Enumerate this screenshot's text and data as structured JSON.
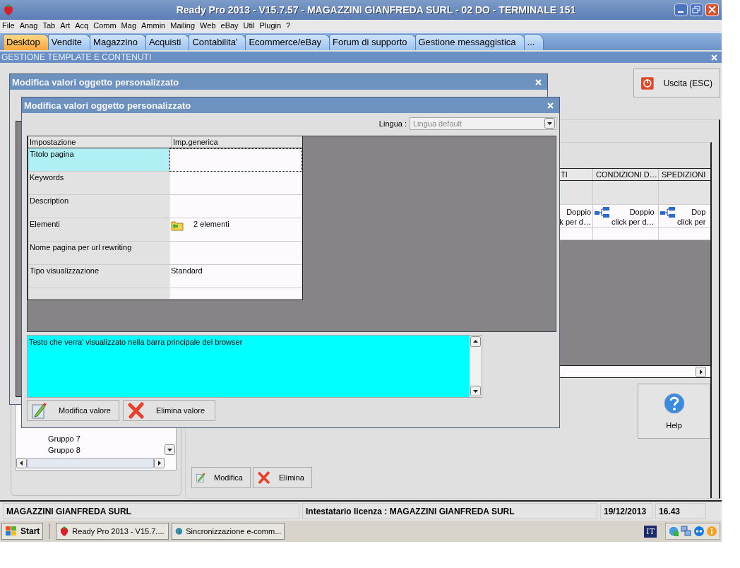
{
  "window": {
    "title": "Ready Pro 2013 - V15.7.57 - MAGAZZINI GIANFREDA SURL - 02 DO - TERMINALE 151"
  },
  "menu": [
    "File",
    "Anag",
    "Tab",
    "Art",
    "Acq",
    "Comm",
    "Mag",
    "Ammin",
    "Mailing",
    "Web",
    "eBay",
    "Util",
    "Plugin",
    "?"
  ],
  "tabs": [
    {
      "label": "Desktop",
      "selected": true
    },
    {
      "label": "Vendite",
      "selected": false
    },
    {
      "label": "Magazzino",
      "selected": false
    },
    {
      "label": "Acquisti",
      "selected": false
    },
    {
      "label": "Contabilita'",
      "selected": false
    },
    {
      "label": "Ecommerce/eBay",
      "selected": false
    },
    {
      "label": "Forum di supporto",
      "selected": false
    },
    {
      "label": "Gestione messaggistica",
      "selected": false
    },
    {
      "label": "...",
      "selected": false
    }
  ],
  "section": {
    "title": "GESTIONE TEMPLATE E CONTENUTI"
  },
  "tree": {
    "items": [
      "Gruppo 7",
      "Gruppo 8"
    ]
  },
  "exit_button": "Uscita (ESC)",
  "help_button": "Help",
  "grid": {
    "columns": [
      "TI",
      "CONDIZIONI D…",
      "SPEDIZIONI"
    ],
    "cells": [
      {
        "line_1": "Doppio",
        "line_2": "k per d…",
        "icon": false
      },
      {
        "line_1": "Doppio",
        "line_2": "click per d…",
        "icon": true
      },
      {
        "line_1": "Dop",
        "line_2": "click per",
        "icon": true
      }
    ]
  },
  "buttons": [
    "Modifica",
    "Elimina"
  ],
  "back_dialog": {
    "title": "Modifica valori oggetto personalizzato"
  },
  "dialog": {
    "title": "Modifica valori oggetto personalizzato",
    "language_label": "Lingua :",
    "language_value": "Lingua default",
    "table": {
      "columns": [
        "Impostazione",
        "Imp.generica"
      ],
      "rows": [
        {
          "setting": "Titolo pagina",
          "value": "",
          "kind": "text",
          "selected": true
        },
        {
          "setting": "Keywords",
          "value": "",
          "kind": "text",
          "selected": false
        },
        {
          "setting": "Description",
          "value": "",
          "kind": "text",
          "selected": false
        },
        {
          "setting": "Elementi",
          "value": "2 elementi",
          "kind": "list",
          "selected": false
        },
        {
          "setting": "Nome pagina per url rewriting",
          "value": "",
          "kind": "text",
          "selected": false
        },
        {
          "setting": "Tipo visualizzazione",
          "value": "Standard",
          "kind": "text",
          "selected": false
        }
      ]
    },
    "description": "Testo che verra' visualizzato nella barra principale del browser",
    "buttons": [
      "Modifica valore",
      "Elimina valore"
    ]
  },
  "status_bar": {
    "company": "MAGAZZINI GIANFREDA SURL",
    "license": "Intestatario licenza : MAGAZZINI GIANFREDA SURL",
    "date": "19/12/2013",
    "time": "16.43"
  },
  "taskbar": {
    "start": "Start",
    "tasks": [
      "Ready Pro 2013 - V15.7....",
      "Sincronizzazione e-comm..."
    ],
    "language": "IT"
  }
}
